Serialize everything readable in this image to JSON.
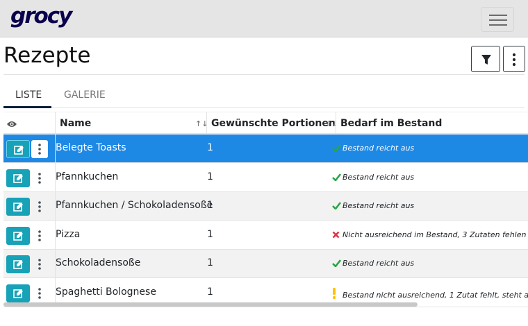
{
  "app": {
    "logo_text": "grocy"
  },
  "page": {
    "title": "Rezepte"
  },
  "tabs": [
    {
      "label": "LISTE",
      "active": true
    },
    {
      "label": "GALERIE",
      "active": false
    }
  ],
  "table": {
    "columns": {
      "name": "Name",
      "servings": "Gewünschte Portionen",
      "fulfillment": "Bedarf im Bestand"
    },
    "rows": [
      {
        "name": "Belegte Toasts",
        "servings": "1",
        "status": "Bestand reicht aus",
        "status_type": "ok",
        "selected": true
      },
      {
        "name": "Pfannkuchen",
        "servings": "1",
        "status": "Bestand reicht aus",
        "status_type": "ok"
      },
      {
        "name": "Pfannkuchen / Schokoladensoße",
        "servings": "1",
        "status": "Bestand reicht aus",
        "status_type": "ok"
      },
      {
        "name": "Pizza",
        "servings": "1",
        "status": "Nicht ausreichend im Bestand, 3 Zutaten fehlen",
        "status_type": "missing"
      },
      {
        "name": "Schokoladensoße",
        "servings": "1",
        "status": "Bestand reicht aus",
        "status_type": "ok"
      },
      {
        "name": "Spaghetti Bolognese",
        "servings": "1",
        "status": "Bestand nicht ausreichend, 1 Zutat fehlt, steht aber b",
        "status_type": "partial"
      }
    ]
  },
  "colors": {
    "brand": "#0b024c",
    "ok": "#28a745",
    "missing": "#dc3545",
    "partial": "#ffc107",
    "selected_row": "#1e88e5",
    "edit_button": "#17a2b8"
  }
}
